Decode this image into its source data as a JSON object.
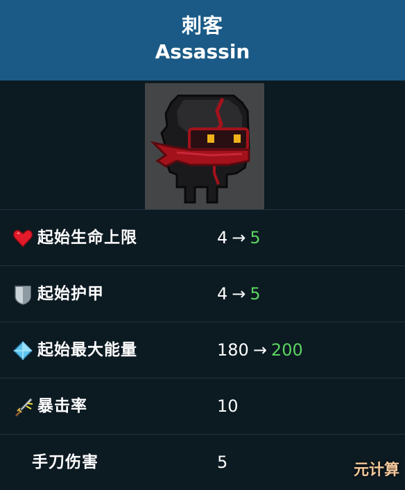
{
  "header": {
    "title_cn": "刺客",
    "title_en": "Assassin"
  },
  "portrait": {
    "icon": "assassin-sprite"
  },
  "stats": [
    {
      "icon": "heart-icon",
      "label": "起始生命上限",
      "old": "4",
      "arrow": "→",
      "new": "5"
    },
    {
      "icon": "shield-icon",
      "label": "起始护甲",
      "old": "4",
      "arrow": "→",
      "new": "5"
    },
    {
      "icon": "energy-crystal-icon",
      "label": "起始最大能量",
      "old": "180",
      "arrow": "→",
      "new": "200"
    },
    {
      "icon": "crit-dagger-icon",
      "label": "暴击率",
      "value": "10"
    },
    {
      "label": "手刀伤害",
      "value": "5"
    }
  ],
  "watermark": "元计算",
  "colors": {
    "header_bg": "#1b5a86",
    "body_bg": "#0c1a22",
    "increase": "#5ad65e",
    "divider": "#223642"
  }
}
